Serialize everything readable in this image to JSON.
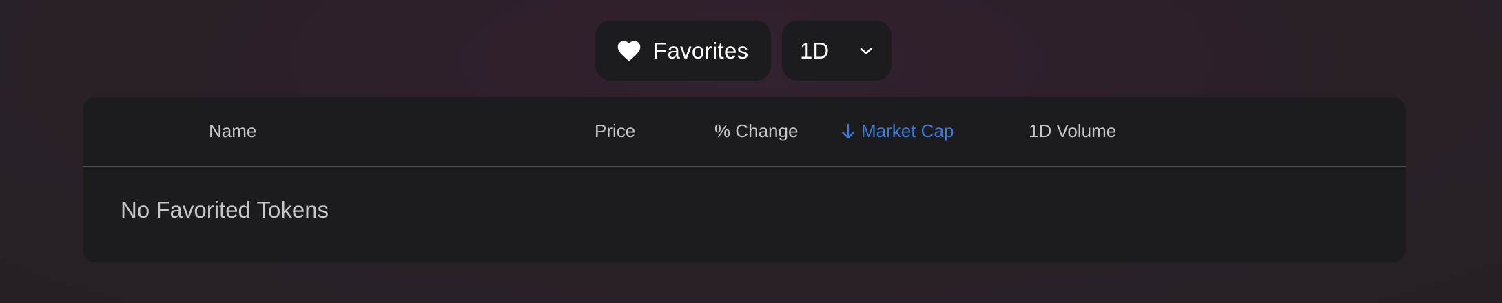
{
  "controls": {
    "favorites_label": "Favorites",
    "favorites_icon": "heart-icon",
    "period_value": "1D",
    "period_icon": "chevron-down-icon"
  },
  "table": {
    "columns": {
      "name": "Name",
      "price": "Price",
      "change": "% Change",
      "market_cap": "Market Cap",
      "volume": "1D Volume"
    },
    "sorted_column": "Market Cap",
    "sort_icon": "arrow-down-icon",
    "sort_color": "#3b7cd9",
    "empty_message": "No Favorited Tokens"
  }
}
